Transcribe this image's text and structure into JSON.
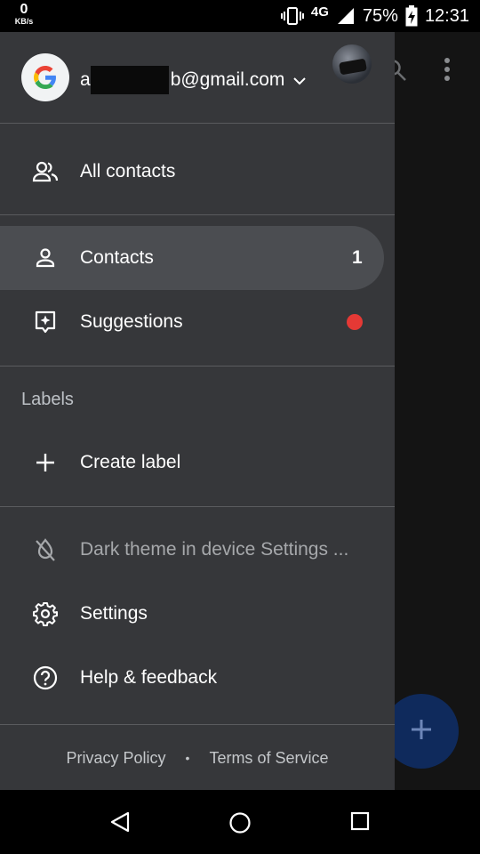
{
  "status_bar": {
    "speed_value": "0",
    "speed_unit": "KB/s",
    "network": "4G",
    "battery": "75%",
    "time": "12:31",
    "icons": [
      "vibrate-icon",
      "signal-icon",
      "battery-charging-icon"
    ]
  },
  "account": {
    "email_suffix": "b@gmail.com",
    "email_prefix_partial": "a"
  },
  "nav": {
    "all_contacts": "All contacts",
    "contacts": "Contacts",
    "contacts_count": "1",
    "suggestions": "Suggestions"
  },
  "labels_section": {
    "title": "Labels",
    "create_label": "Create label"
  },
  "misc": {
    "dark_theme": "Dark theme in device Settings ...",
    "settings": "Settings",
    "help": "Help & feedback"
  },
  "footer": {
    "privacy": "Privacy Policy",
    "separator": "•",
    "terms": "Terms of Service"
  },
  "colors": {
    "drawer_bg": "#36373a",
    "active_bg": "#4b4d51",
    "badge_dot": "#e53935",
    "fab": "#0f2a5c"
  }
}
